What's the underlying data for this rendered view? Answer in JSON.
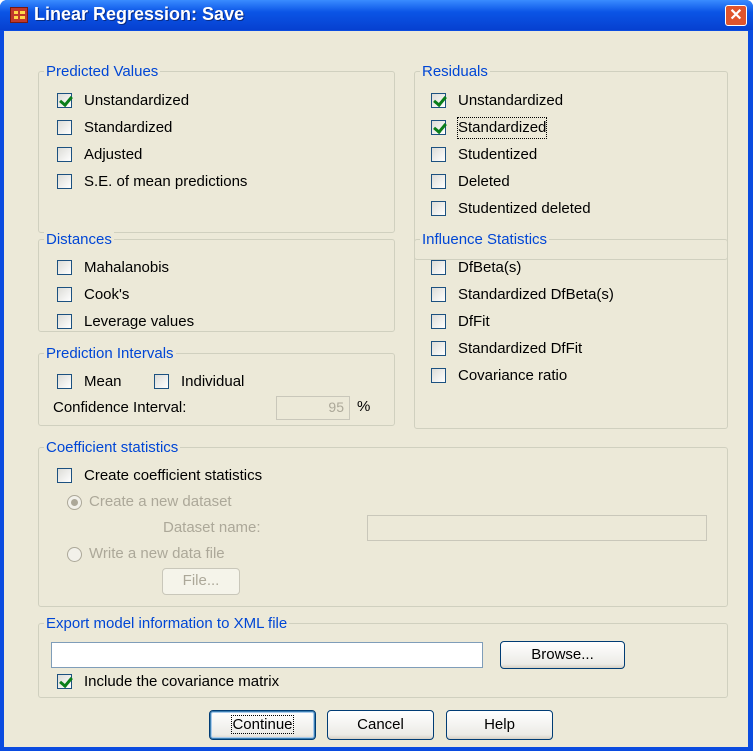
{
  "title": "Linear Regression: Save",
  "close_glyph": "✕",
  "predicted": {
    "legend": "Predicted Values",
    "unstandardized": "Unstandardized",
    "standardized": "Standardized",
    "adjusted": "Adjusted",
    "se_mean": "S.E. of mean predictions"
  },
  "residuals": {
    "legend": "Residuals",
    "unstandardized": "Unstandardized",
    "standardized": "Standardized",
    "studentized": "Studentized",
    "deleted": "Deleted",
    "studentized_deleted": "Studentized deleted"
  },
  "distances": {
    "legend": "Distances",
    "mahalanobis": "Mahalanobis",
    "cooks": "Cook's",
    "leverage": "Leverage values"
  },
  "influence": {
    "legend": "Influence Statistics",
    "dfbeta": "DfBeta(s)",
    "std_dfbeta": "Standardized DfBeta(s)",
    "dffit": "DfFit",
    "std_dffit": "Standardized DfFit",
    "cov_ratio": "Covariance ratio"
  },
  "prediction_intervals": {
    "legend": "Prediction Intervals",
    "mean": "Mean",
    "individual": "Individual",
    "ci_label": "Confidence Interval:",
    "ci_value": "95",
    "percent": "%"
  },
  "coefficient": {
    "legend": "Coefficient statistics",
    "create": "Create coefficient statistics",
    "new_dataset": "Create a new dataset",
    "dataset_name_label": "Dataset name:",
    "dataset_name_value": "",
    "write_file": "Write a new data file",
    "file_button": "File..."
  },
  "export": {
    "legend": "Export model information to XML file",
    "path_value": "",
    "browse_button": "Browse...",
    "include_cov": "Include the covariance matrix"
  },
  "buttons": {
    "continue": "Continue",
    "cancel": "Cancel",
    "help": "Help"
  },
  "checked": {
    "predicted_unstandardized": true,
    "residual_unstandardized": true,
    "residual_standardized": true,
    "include_cov": true
  },
  "colors": {
    "titlebar": "#0b55e6",
    "dialog_bg": "#ece9d8",
    "legend_text": "#0046d5",
    "checkmark": "#0a7e1a",
    "close_button": "#e0542c"
  },
  "icons": {
    "app": "spss-grid-icon",
    "close": "close-icon",
    "check": "checkmark"
  }
}
